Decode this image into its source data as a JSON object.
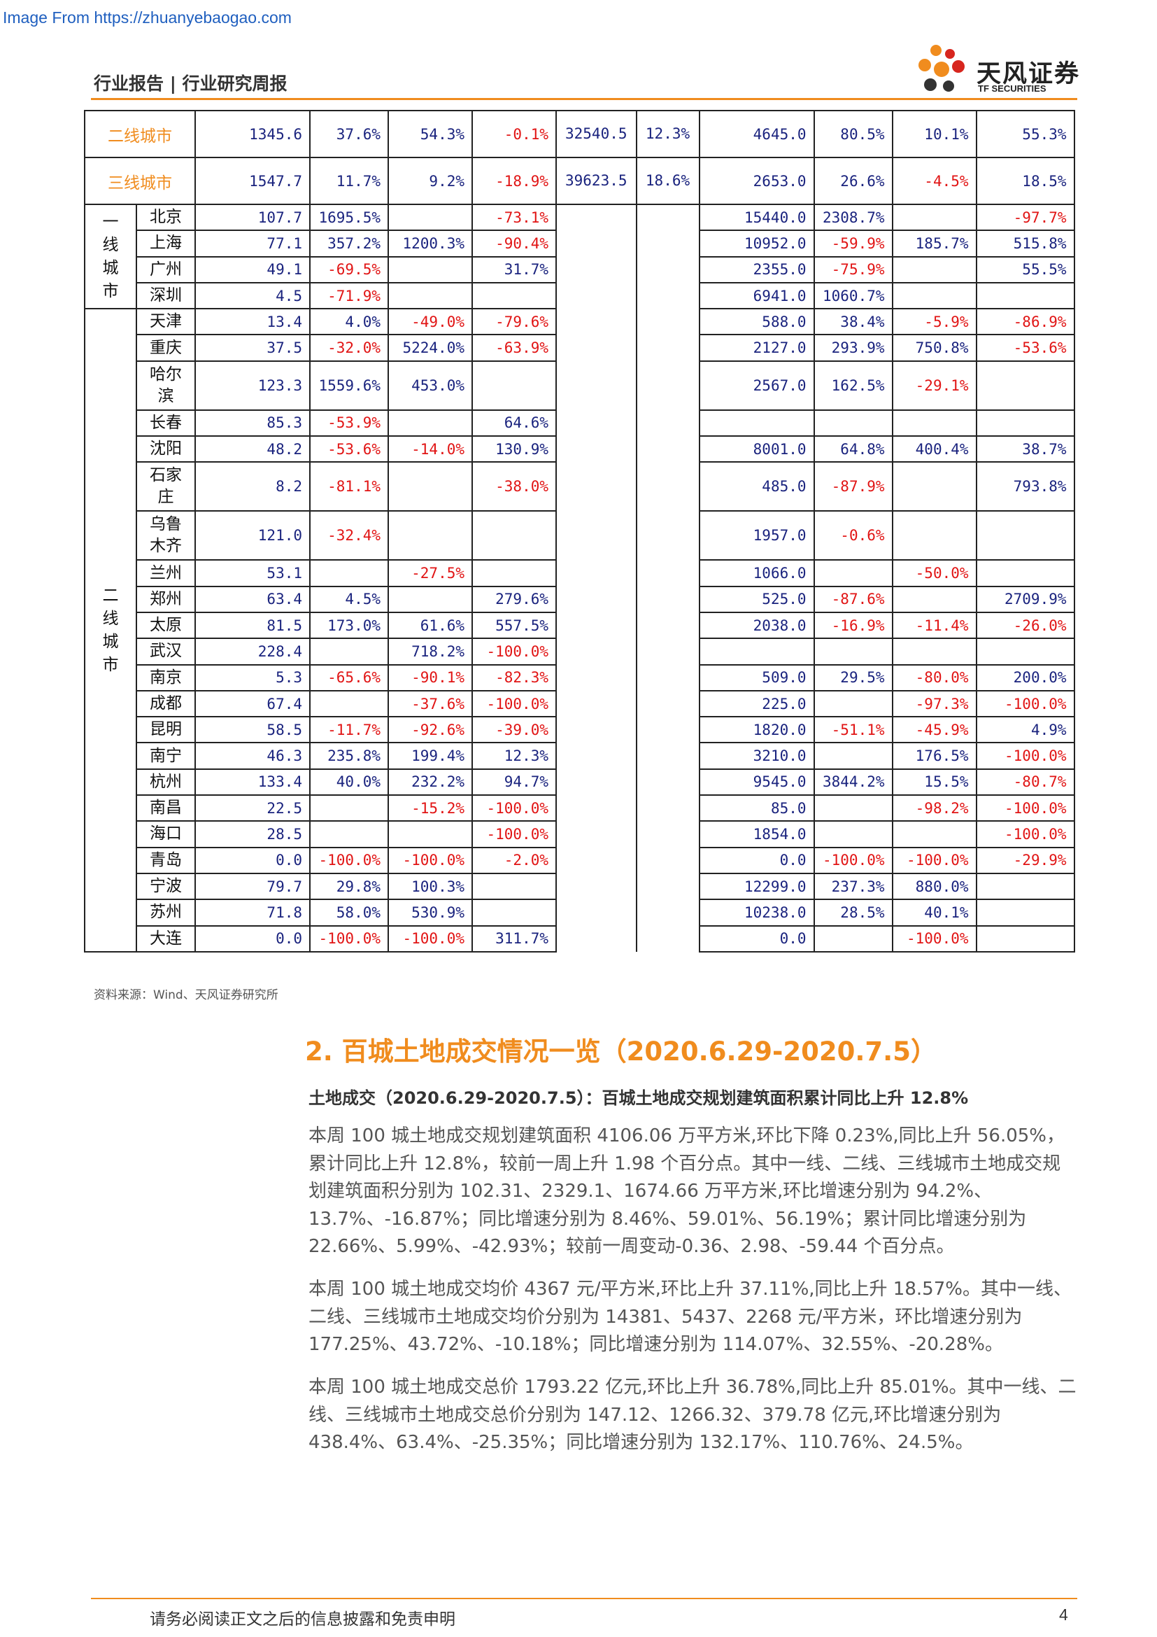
{
  "watermark": "Image From https://zhuanyebaogao.com",
  "header": {
    "title": "行业报告 | 行业研究周报",
    "logo_cn": "天风证券",
    "logo_en": "TF SECURITIES"
  },
  "table": {
    "tier_rows": [
      {
        "name": "二线城市",
        "values": [
          "1345.6",
          "37.6%",
          "54.3%",
          "-0.1%",
          "32540.5",
          "12.3%",
          "4645.0",
          "80.5%",
          "10.1%",
          "55.3%"
        ]
      },
      {
        "name": "三线城市",
        "values": [
          "1547.7",
          "11.7%",
          "9.2%",
          "-18.9%",
          "39623.5",
          "18.6%",
          "2653.0",
          "26.6%",
          "-4.5%",
          "18.5%"
        ]
      }
    ],
    "groups": [
      {
        "label": "一线城市",
        "rows": [
          {
            "city": "北京",
            "values": [
              "107.7",
              "1695.5%",
              "",
              "-73.1%",
              "15440.0",
              "2308.7%",
              "",
              "-97.7%"
            ]
          },
          {
            "city": "上海",
            "values": [
              "77.1",
              "357.2%",
              "1200.3%",
              "-90.4%",
              "10952.0",
              "-59.9%",
              "185.7%",
              "515.8%"
            ]
          },
          {
            "city": "广州",
            "values": [
              "49.1",
              "-69.5%",
              "",
              "31.7%",
              "2355.0",
              "-75.9%",
              "",
              "55.5%"
            ]
          },
          {
            "city": "深圳",
            "values": [
              "4.5",
              "-71.9%",
              "",
              "",
              "6941.0",
              "1060.7%",
              "",
              ""
            ]
          }
        ]
      },
      {
        "label": "二线城市",
        "rows": [
          {
            "city": "天津",
            "values": [
              "13.4",
              "4.0%",
              "-49.0%",
              "-79.6%",
              "588.0",
              "38.4%",
              "-5.9%",
              "-86.9%"
            ]
          },
          {
            "city": "重庆",
            "values": [
              "37.5",
              "-32.0%",
              "5224.0%",
              "-63.9%",
              "2127.0",
              "293.9%",
              "750.8%",
              "-53.6%"
            ]
          },
          {
            "city": "哈尔滨",
            "values": [
              "123.3",
              "1559.6%",
              "453.0%",
              "",
              "2567.0",
              "162.5%",
              "-29.1%",
              ""
            ]
          },
          {
            "city": "长春",
            "values": [
              "85.3",
              "-53.9%",
              "",
              "64.6%",
              "",
              "",
              "",
              ""
            ]
          },
          {
            "city": "沈阳",
            "values": [
              "48.2",
              "-53.6%",
              "-14.0%",
              "130.9%",
              "8001.0",
              "64.8%",
              "400.4%",
              "38.7%"
            ]
          },
          {
            "city": "石家庄",
            "values": [
              "8.2",
              "-81.1%",
              "",
              "-38.0%",
              "485.0",
              "-87.9%",
              "",
              "793.8%"
            ]
          },
          {
            "city": "乌鲁木齐",
            "values": [
              "121.0",
              "-32.4%",
              "",
              "",
              "1957.0",
              "-0.6%",
              "",
              ""
            ]
          },
          {
            "city": "兰州",
            "values": [
              "53.1",
              "",
              "-27.5%",
              "",
              "1066.0",
              "",
              "-50.0%",
              ""
            ]
          },
          {
            "city": "郑州",
            "values": [
              "63.4",
              "4.5%",
              "",
              "279.6%",
              "525.0",
              "-87.6%",
              "",
              "2709.9%"
            ]
          },
          {
            "city": "太原",
            "values": [
              "81.5",
              "173.0%",
              "61.6%",
              "557.5%",
              "2038.0",
              "-16.9%",
              "-11.4%",
              "-26.0%"
            ]
          },
          {
            "city": "武汉",
            "values": [
              "228.4",
              "",
              "718.2%",
              "-100.0%",
              "",
              "",
              "",
              ""
            ]
          },
          {
            "city": "南京",
            "values": [
              "5.3",
              "-65.6%",
              "-90.1%",
              "-82.3%",
              "509.0",
              "29.5%",
              "-80.0%",
              "200.0%"
            ]
          },
          {
            "city": "成都",
            "values": [
              "67.4",
              "",
              "-37.6%",
              "-100.0%",
              "225.0",
              "",
              "-97.3%",
              "-100.0%"
            ]
          },
          {
            "city": "昆明",
            "values": [
              "58.5",
              "-11.7%",
              "-92.6%",
              "-39.0%",
              "1820.0",
              "-51.1%",
              "-45.9%",
              "4.9%"
            ]
          },
          {
            "city": "南宁",
            "values": [
              "46.3",
              "235.8%",
              "199.4%",
              "12.3%",
              "3210.0",
              "",
              "176.5%",
              "-100.0%"
            ]
          },
          {
            "city": "杭州",
            "values": [
              "133.4",
              "40.0%",
              "232.2%",
              "94.7%",
              "9545.0",
              "3844.2%",
              "15.5%",
              "-80.7%"
            ]
          },
          {
            "city": "南昌",
            "values": [
              "22.5",
              "",
              "-15.2%",
              "-100.0%",
              "85.0",
              "",
              "-98.2%",
              "-100.0%"
            ]
          },
          {
            "city": "海口",
            "values": [
              "28.5",
              "",
              "",
              "-100.0%",
              "1854.0",
              "",
              "",
              "-100.0%"
            ]
          },
          {
            "city": "青岛",
            "values": [
              "0.0",
              "-100.0%",
              "-100.0%",
              "-2.0%",
              "0.0",
              "-100.0%",
              "-100.0%",
              "-29.9%"
            ]
          },
          {
            "city": "宁波",
            "values": [
              "79.7",
              "29.8%",
              "100.3%",
              "",
              "12299.0",
              "237.3%",
              "880.0%",
              ""
            ]
          },
          {
            "city": "苏州",
            "values": [
              "71.8",
              "58.0%",
              "530.9%",
              "",
              "10238.0",
              "28.5%",
              "40.1%",
              ""
            ]
          },
          {
            "city": "大连",
            "values": [
              "0.0",
              "-100.0%",
              "-100.0%",
              "311.7%",
              "0.0",
              "",
              "-100.0%",
              ""
            ]
          }
        ]
      }
    ]
  },
  "source": "资料来源：Wind、天风证券研究所",
  "section": {
    "title": "2. 百城土地成交情况一览（2020.6.29-2020.7.5）",
    "subtitle": "土地成交（2020.6.29-2020.7.5）：百城土地成交规划建筑面积累计同比上升 12.8%",
    "paragraphs": [
      "本周 100 城土地成交规划建筑面积 4106.06 万平方米,环比下降 0.23%,同比上升 56.05%，累计同比上升 12.8%，较前一周上升 1.98 个百分点。其中一线、二线、三线城市土地成交规划建筑面积分别为 102.31、2329.1、1674.66 万平方米,环比增速分别为 94.2%、13.7%、-16.87%；同比增速分别为 8.46%、59.01%、56.19%；累计同比增速分别为 22.66%、5.99%、-42.93%；较前一周变动-0.36、2.98、-59.44 个百分点。",
      "本周 100 城土地成交均价 4367 元/平方米,环比上升 37.11%,同比上升 18.57%。其中一线、二线、三线城市土地成交均价分别为 14381、5437、2268 元/平方米，环比增速分别为 177.25%、43.72%、-10.18%；同比增速分别为 114.07%、32.55%、-20.28%。",
      "本周 100 城土地成交总价 1793.22 亿元,环比上升 36.78%,同比上升 85.01%。其中一线、二线、三线城市土地成交总价分别为 147.12、1266.32、379.78 亿元,环比增速分别为 438.4%、63.4%、-25.35%；同比增速分别为 132.17%、110.76%、24.5%。"
    ]
  },
  "footer": {
    "disclaimer": "请务必阅读正文之后的信息披露和免责申明",
    "page": "4"
  },
  "colors": {
    "accent": "#f08c1e",
    "positive": "#1a237e",
    "negative": "#e11414"
  }
}
